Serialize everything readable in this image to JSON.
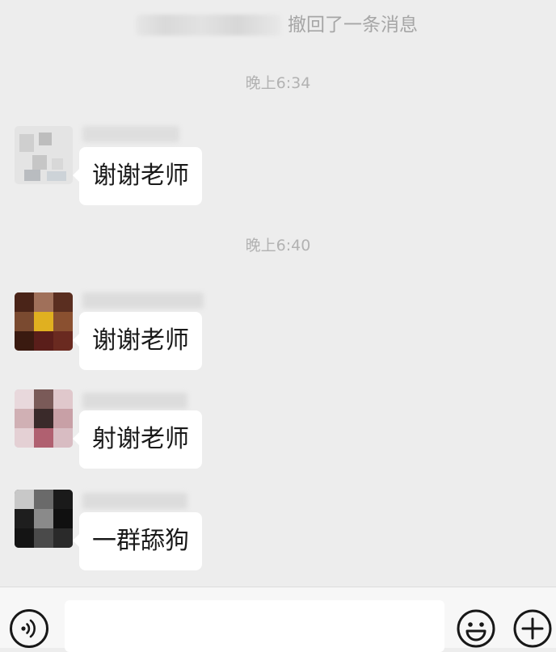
{
  "chat": {
    "recall_notice": "撤回了一条消息",
    "timestamps": [
      "晚上6:34",
      "晚上6:40"
    ],
    "messages": [
      {
        "text": "谢谢老师"
      },
      {
        "text": "谢谢老师"
      },
      {
        "text": "射谢老师"
      },
      {
        "text": "一群舔狗"
      }
    ]
  },
  "input_bar": {
    "voice_icon": "voice-icon",
    "emoji_icon": "emoji-icon",
    "add_icon": "plus-icon",
    "input_value": ""
  },
  "colors": {
    "background": "#ededed",
    "bubble": "#ffffff",
    "timestamp_text": "#b2b2b2",
    "recall_text": "#a6a6a6",
    "input_bar": "#f7f7f7"
  }
}
